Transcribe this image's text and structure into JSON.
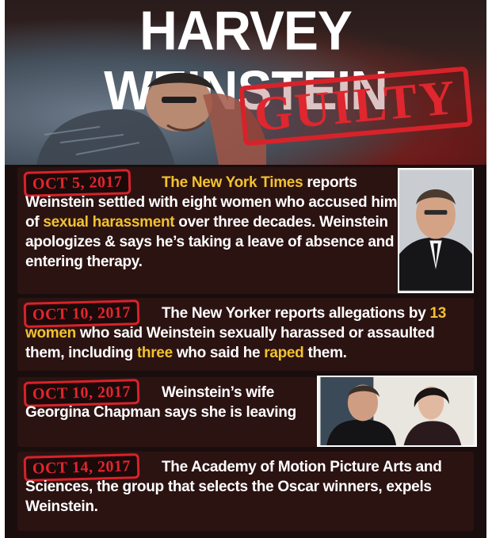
{
  "headline": "HARVEY WEINSTEIN",
  "stamp": "GUILTY",
  "entries": [
    {
      "date": "OCT 5, 2017",
      "segments": [
        {
          "text": "The New York Times",
          "hl": true
        },
        {
          "text": " reports Weinstein settled with eight women who accused him of ",
          "hl": false
        },
        {
          "text": "sexual harassment",
          "hl": true
        },
        {
          "text": " over three decades. Weinstein apologizes & says he’s taking a leave of absence and entering therapy.",
          "hl": false
        }
      ]
    },
    {
      "date": "OCT 10, 2017",
      "segments": [
        {
          "text": "The New Yorker reports allegations by ",
          "hl": false
        },
        {
          "text": "13 women",
          "hl": true
        },
        {
          "text": " who said Weinstein sexually harassed or assaulted them, including ",
          "hl": false
        },
        {
          "text": "three",
          "hl": true
        },
        {
          "text": " who said he ",
          "hl": false
        },
        {
          "text": "raped",
          "hl": true
        },
        {
          "text": " them.",
          "hl": false
        }
      ]
    },
    {
      "date": "OCT 10, 2017",
      "segments": [
        {
          "text": "Weinstein’s wife Georgina Chapman says she is leaving",
          "hl": false
        }
      ]
    },
    {
      "date": "OCT 14, 2017",
      "segments": [
        {
          "text": "The Academy of Motion Picture Arts and Sciences, the group that selects the Oscar winners, expels Weinstein.",
          "hl": false
        }
      ]
    }
  ],
  "colors": {
    "accent_red": "#d8222a",
    "highlight_yellow": "#f2c230",
    "panel_bg": "#2d1412"
  }
}
